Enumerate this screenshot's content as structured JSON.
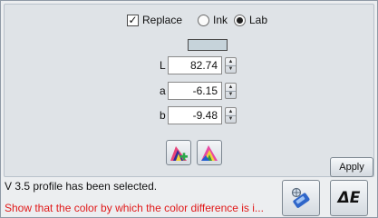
{
  "mode": {
    "replace_label": "Replace",
    "replace_checked": true,
    "ink_label": "Ink",
    "lab_label": "Lab",
    "selected": "Lab"
  },
  "swatch_color": "#c6d3da",
  "lab": {
    "l_label": "L",
    "l_value": "82.74",
    "a_label": "a",
    "a_value": "-6.15",
    "b_label": "b",
    "b_value": "-9.48"
  },
  "actions": {
    "apply_label": "Apply",
    "delta_e_label": "ΔE"
  },
  "status": {
    "message": "V 3.5 profile has been selected.",
    "warning": "Show that the color by which the color difference is i..."
  },
  "icons": [
    "add-profile-color-icon",
    "profile-color-icon",
    "color-measure-icon"
  ],
  "colors": {
    "warning": "#e11a1a",
    "panel": "#dfe3e7"
  }
}
